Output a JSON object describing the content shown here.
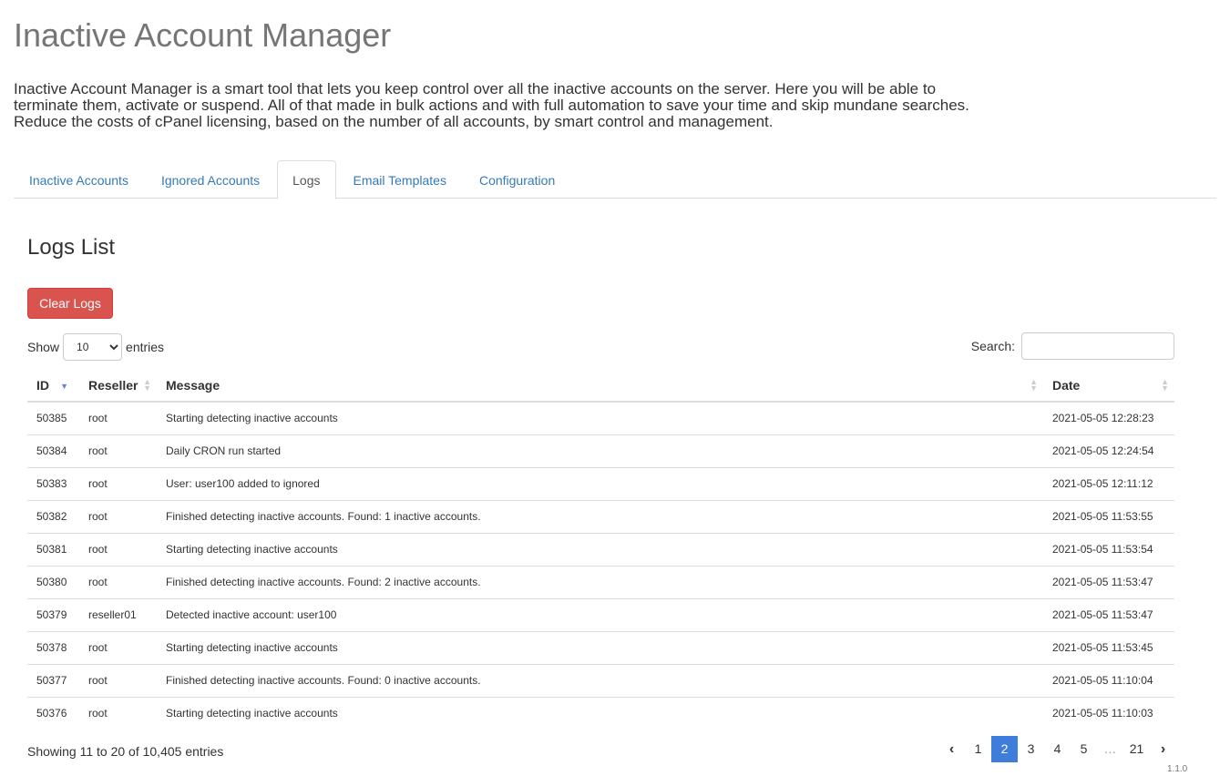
{
  "header": {
    "title": "Inactive Account Manager",
    "description": "Inactive Account Manager is a smart tool that lets you keep control over all the inactive accounts on the server. Here you will be able to terminate them, activate or suspend. All of that made in bulk actions and with full automation to save your time and skip mundane searches. Reduce the costs of cPanel licensing, based on the number of all accounts, by smart control and management."
  },
  "tabs": [
    {
      "label": "Inactive Accounts",
      "active": false
    },
    {
      "label": "Ignored Accounts",
      "active": false
    },
    {
      "label": "Logs",
      "active": true
    },
    {
      "label": "Email Templates",
      "active": false
    },
    {
      "label": "Configuration",
      "active": false
    }
  ],
  "logs": {
    "title": "Logs List",
    "clear_button": "Clear Logs",
    "show_label": "Show",
    "entries_label": "entries",
    "page_length": "10",
    "search_label": "Search:",
    "search_value": "",
    "columns": [
      "ID",
      "Reseller",
      "Message",
      "Date"
    ],
    "rows": [
      {
        "id": "50385",
        "reseller": "root",
        "message": "Starting detecting inactive accounts",
        "date": "2021-05-05 12:28:23"
      },
      {
        "id": "50384",
        "reseller": "root",
        "message": "Daily CRON run started",
        "date": "2021-05-05 12:24:54"
      },
      {
        "id": "50383",
        "reseller": "root",
        "message": "User: user100 added to ignored",
        "date": "2021-05-05 12:11:12"
      },
      {
        "id": "50382",
        "reseller": "root",
        "message": "Finished detecting inactive accounts. Found: 1 inactive accounts.",
        "date": "2021-05-05 11:53:55"
      },
      {
        "id": "50381",
        "reseller": "root",
        "message": "Starting detecting inactive accounts",
        "date": "2021-05-05 11:53:54"
      },
      {
        "id": "50380",
        "reseller": "root",
        "message": "Finished detecting inactive accounts. Found: 2 inactive accounts.",
        "date": "2021-05-05 11:53:47"
      },
      {
        "id": "50379",
        "reseller": "reseller01",
        "message": "Detected inactive account: user100",
        "date": "2021-05-05 11:53:47"
      },
      {
        "id": "50378",
        "reseller": "root",
        "message": "Starting detecting inactive accounts",
        "date": "2021-05-05 11:53:45"
      },
      {
        "id": "50377",
        "reseller": "root",
        "message": "Finished detecting inactive accounts. Found: 0 inactive accounts.",
        "date": "2021-05-05 11:10:04"
      },
      {
        "id": "50376",
        "reseller": "root",
        "message": "Starting detecting inactive accounts",
        "date": "2021-05-05 11:10:03"
      }
    ],
    "info": "Showing 11 to 20 of 10,405 entries",
    "pagination": {
      "prev_icon": "chevron-left-icon",
      "next_icon": "chevron-right-icon",
      "pages": [
        "1",
        "2",
        "3",
        "4",
        "5",
        "…",
        "21"
      ],
      "current": "2"
    }
  },
  "version": "1.1.0"
}
